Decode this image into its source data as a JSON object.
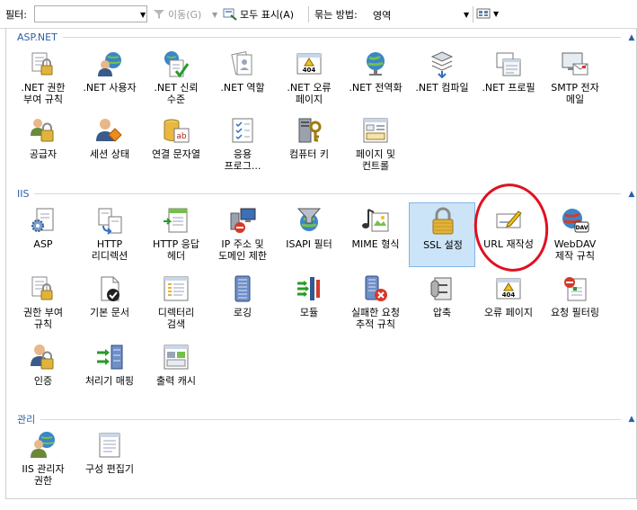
{
  "toolbar": {
    "filter_label": "필터:",
    "filter_value": "",
    "go_label": "이동(G)",
    "show_all_label": "모두 표시(A)",
    "group_by_label": "묶는 방법:",
    "group_by_value": "영역"
  },
  "groups": [
    {
      "title": "ASP.NET",
      "items": [
        {
          "label": ".NET 권한\n부여 규칙",
          "icon": "lock-users-icon"
        },
        {
          "label": ".NET 사용자",
          "icon": "user-globe-icon"
        },
        {
          "label": ".NET 신뢰\n수준",
          "icon": "check-document-icon"
        },
        {
          "label": ".NET 역할",
          "icon": "role-document-icon"
        },
        {
          "label": ".NET 오류\n페이지",
          "icon": "error-404-icon"
        },
        {
          "label": ".NET 전역화",
          "icon": "globe-icon"
        },
        {
          "label": ".NET 컴파일",
          "icon": "compile-stack-icon"
        },
        {
          "label": ".NET 프로필",
          "icon": "profile-window-icon"
        },
        {
          "label": "SMTP 전자\n메일",
          "icon": "email-monitor-icon"
        },
        {
          "label": "공급자",
          "icon": "provider-users-icon"
        },
        {
          "label": "세션 상태",
          "icon": "session-user-icon"
        },
        {
          "label": "연결 문자열",
          "icon": "connection-string-icon"
        },
        {
          "label": "응용\n프로그...",
          "icon": "app-settings-icon"
        },
        {
          "label": "컴퓨터 키",
          "icon": "machine-key-icon"
        },
        {
          "label": "페이지 및\n컨트롤",
          "icon": "page-controls-icon"
        }
      ]
    },
    {
      "title": "IIS",
      "items": [
        {
          "label": "ASP",
          "icon": "asp-gear-icon"
        },
        {
          "label": "HTTP\n리디렉션",
          "icon": "redirect-icon"
        },
        {
          "label": "HTTP 응답\n헤더",
          "icon": "response-header-icon"
        },
        {
          "label": "IP 주소 및\n도메인 제한",
          "icon": "ip-restriction-icon"
        },
        {
          "label": "ISAPI 필터",
          "icon": "isapi-filter-icon"
        },
        {
          "label": "MIME 형식",
          "icon": "mime-icon"
        },
        {
          "label": "SSL 설정",
          "icon": "ssl-lock-icon",
          "selected": true
        },
        {
          "label": "URL 재작성",
          "icon": "url-rewrite-icon"
        },
        {
          "label": "WebDAV\n제작 규칙",
          "icon": "webdav-icon"
        },
        {
          "label": "권한 부여\n규칙",
          "icon": "authz-lock-icon"
        },
        {
          "label": "기본 문서",
          "icon": "default-document-icon"
        },
        {
          "label": "디렉터리\n검색",
          "icon": "directory-browse-icon"
        },
        {
          "label": "로깅",
          "icon": "logging-icon"
        },
        {
          "label": "모듈",
          "icon": "modules-icon"
        },
        {
          "label": "실패한 요청\n추적 규칙",
          "icon": "failed-request-icon"
        },
        {
          "label": "압축",
          "icon": "compression-icon"
        },
        {
          "label": "오류 페이지",
          "icon": "error-pages-icon"
        },
        {
          "label": "요청 필터링",
          "icon": "request-filter-icon"
        },
        {
          "label": "인증",
          "icon": "authentication-icon"
        },
        {
          "label": "처리기 매핑",
          "icon": "handler-mapping-icon"
        },
        {
          "label": "출력 캐시",
          "icon": "output-cache-icon"
        }
      ]
    },
    {
      "title": "관리",
      "items": [
        {
          "label": "IIS 관리자\n권한",
          "icon": "manager-permissions-icon"
        },
        {
          "label": "구성 편집기",
          "icon": "config-editor-icon"
        }
      ]
    }
  ]
}
